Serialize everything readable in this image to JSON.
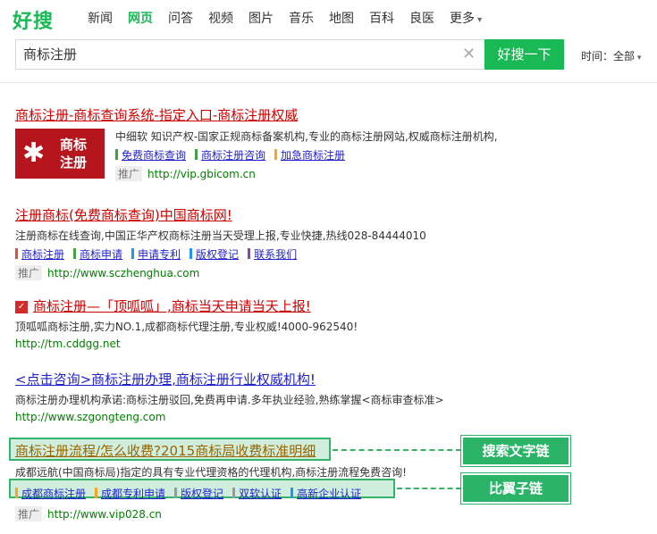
{
  "logo": "好搜",
  "nav": [
    "新闻",
    "网页",
    "问答",
    "视频",
    "图片",
    "音乐",
    "地图",
    "百科",
    "良医",
    "更多"
  ],
  "nav_active_index": 1,
  "search": {
    "value": "商标注册",
    "button": "好搜一下",
    "clear_icon": "close-icon"
  },
  "time_filter": "时间：全部",
  "results": [
    {
      "title": "商标注册-商标查询系统-指定入口-商标注册权威",
      "image_text": "商标\n注册",
      "desc": "中细软 知识产权-国家正规商标备案机构,专业的商标注册网站,权威商标注册机构,",
      "links": [
        "免费商标查询",
        "商标注册咨询",
        "加急商标注册"
      ],
      "tag": "推广",
      "url": "http://vip.gbicom.cn"
    },
    {
      "title": "注册商标(免费商标查询)中国商标网!",
      "desc": "注册商标在线查询,中国正华产权商标注册当天受理上报,专业快捷,热线028-84444010",
      "links": [
        "商标注册",
        "商标申请",
        "申请专利",
        "版权登记",
        "联系我们"
      ],
      "tag": "推广",
      "url": "http://www.sczhenghua.com"
    },
    {
      "title": "商标注册—「顶呱呱」,商标当天申请当天上报!",
      "desc": "顶呱呱商标注册,实力NO.1,成都商标代理注册,专业权威!4000-962540!",
      "url": "http://tm.cddgg.net"
    },
    {
      "title": "<点击咨询>商标注册办理,商标注册行业权威机构!",
      "desc": "商标注册办理机构承诺:商标注册驳回,免费再申请.多年执业经验,熟练掌握<商标审查标准>",
      "url": "http://www.szgongteng.com"
    },
    {
      "title": "商标注册流程/怎么收费?2015商标局收费标准明细",
      "desc": "成都远航(中国商标局)指定的具有专业代理资格的代理机构,商标注册流程免费咨询!",
      "links": [
        "成都商标注册",
        "成都专利申请",
        "版权登记",
        "双软认证",
        "高新企业认证"
      ],
      "tag": "推广",
      "url": "http://www.vip028.cn"
    }
  ],
  "annotations": {
    "title_chain": "搜索文字链",
    "sub_links": "比翼子链"
  }
}
